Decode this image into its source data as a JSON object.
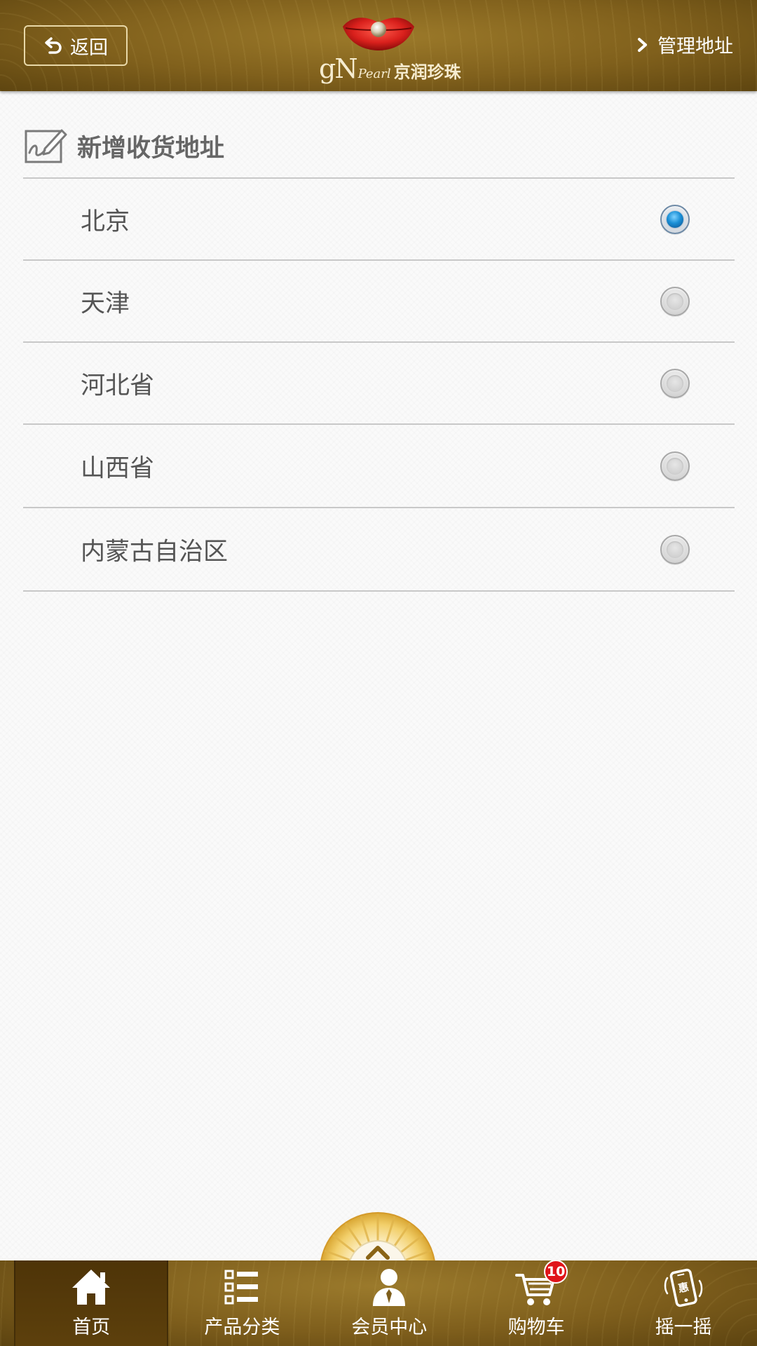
{
  "header": {
    "back_label": "返回",
    "logo": {
      "brand_latin": "gN",
      "brand_pearl": "Pearl",
      "brand_cn": "京润珍珠"
    },
    "manage_label": "管理地址"
  },
  "section": {
    "title": "新增收货地址"
  },
  "regions": [
    {
      "label": "北京",
      "selected": true
    },
    {
      "label": "天津",
      "selected": false
    },
    {
      "label": "河北省",
      "selected": false
    },
    {
      "label": "山西省",
      "selected": false
    },
    {
      "label": "内蒙古自治区",
      "selected": false
    }
  ],
  "tabbar": {
    "items": [
      {
        "label": "首页",
        "icon": "home-icon",
        "active": true
      },
      {
        "label": "产品分类",
        "icon": "list-icon",
        "active": false
      },
      {
        "label": "会员中心",
        "icon": "user-icon",
        "active": false
      },
      {
        "label": "购物车",
        "icon": "cart-icon",
        "active": false
      },
      {
        "label": "摇一摇",
        "icon": "shake-phone-icon",
        "active": false
      }
    ],
    "cart_badge": "10",
    "shake_badge_text": "惠"
  },
  "colors": {
    "header_gold": "#80601c",
    "radio_selected": "#1a8fd6",
    "badge_red": "#e0141a",
    "text_gray": "#555555"
  }
}
